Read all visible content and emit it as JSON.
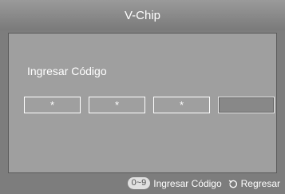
{
  "title": "V-Chip",
  "code_entry": {
    "label": "Ingresar Código",
    "slots": [
      "*",
      "*",
      "*",
      ""
    ],
    "active_slot": 4
  },
  "footer": {
    "number_key": "0~9",
    "enter_label": "Ingresar Código",
    "return_icon": "return-arrow-icon",
    "return_label": "Regresar"
  },
  "colors": {
    "panel": "#9f9f9f",
    "background": "#7d7d7d",
    "text": "#ffffff"
  }
}
